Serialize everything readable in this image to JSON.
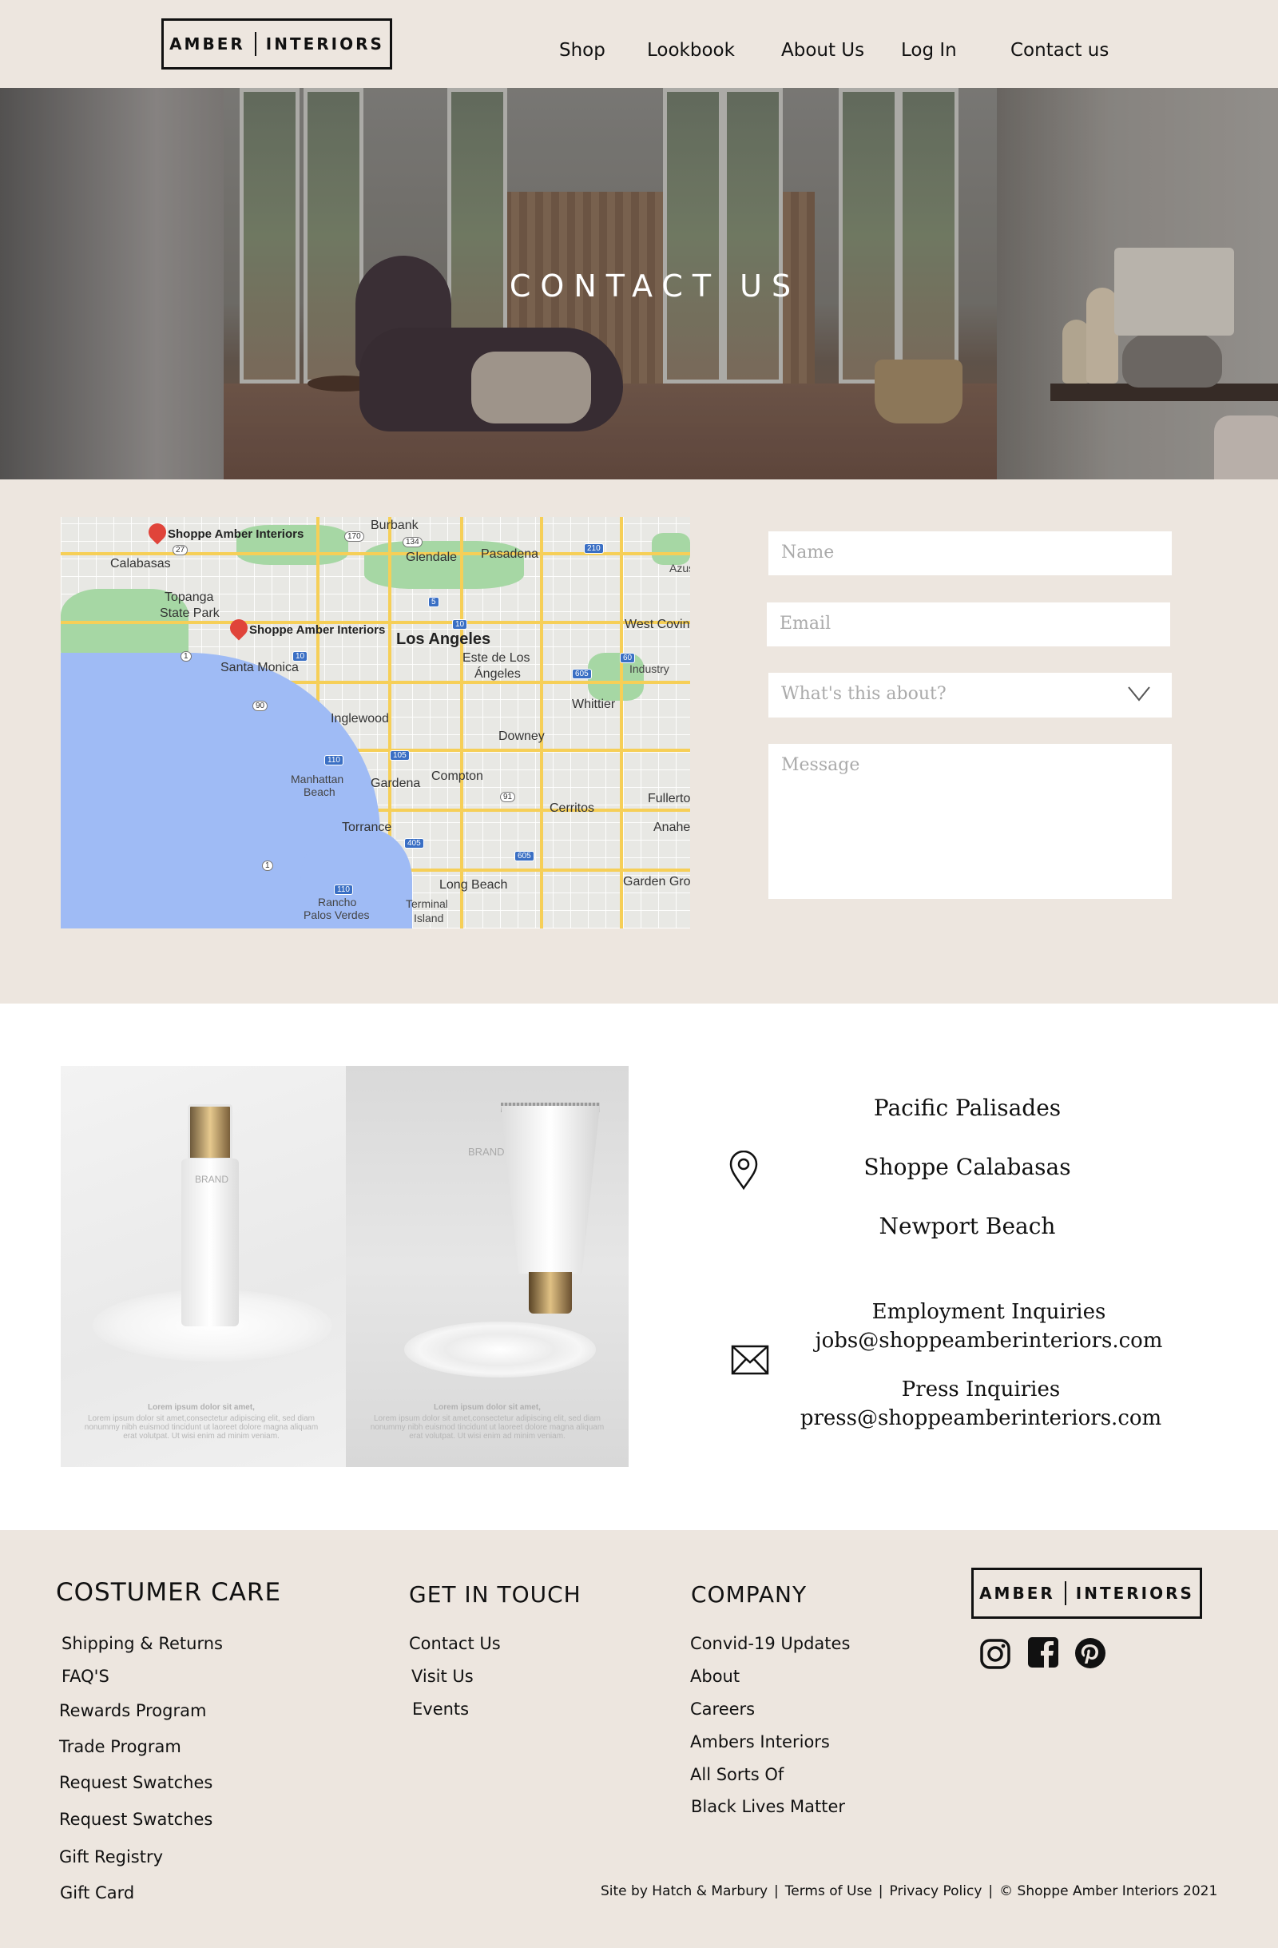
{
  "header": {
    "logo_left": "AMBER",
    "logo_right": "INTERIORS",
    "nav": [
      "Shop",
      "Lookbook",
      "About Us",
      "Log In",
      "Contact us"
    ]
  },
  "hero": {
    "title": "CONTACT US"
  },
  "map": {
    "pins": [
      "Shoppe Amber Interiors",
      "Shoppe Amber Interiors"
    ],
    "places": [
      "Burbank",
      "Glendale",
      "Pasadena",
      "Calabasas",
      "Topanga",
      "State Park",
      "Los Angeles",
      "West Covina",
      "Santa Monica",
      "Este de Los",
      "Ángeles",
      "Industry",
      "Whittier",
      "Inglewood",
      "Downey",
      "Manhattan",
      "Beach",
      "Gardena",
      "Compton",
      "Cerritos",
      "Fullerton",
      "Torrance",
      "Anaheim",
      "Long Beach",
      "Garden Grove",
      "Rancho",
      "Palos Verdes",
      "Terminal",
      "Island",
      "Azusa"
    ],
    "shields": [
      "170",
      "134",
      "210",
      "210",
      "27",
      "5",
      "10",
      "10",
      "60",
      "605",
      "90",
      "110",
      "105",
      "91",
      "405",
      "605",
      "1",
      "1",
      "110"
    ]
  },
  "form": {
    "name_placeholder": "Name",
    "email_placeholder": "Email",
    "topic_placeholder": "What's this about?",
    "message_placeholder": "Message"
  },
  "product": {
    "brand_1": "BRAND",
    "brand_2": "BRAND",
    "lorem_title_1": "Lorem ipsum dolor sit amet,",
    "lorem_body_1": "Lorem ipsum dolor sit amet,consectetur adipiscing elit, sed diam nonummy nibh euismod tincidunt ut laoreet dolore magna aliquam erat volutpat. Ut wisi enim ad minim veniam.",
    "lorem_title_2": "Lorem ipsum dolor sit amet,",
    "lorem_body_2": "Lorem ipsum dolor sit amet,consectetur adipiscing elit, sed diam nonummy nibh euismod tincidunt ut laoreet dolore magna aliquam erat volutpat. Ut wisi enim ad minim veniam."
  },
  "locations": [
    "Pacific Palisades",
    "Shoppe Calabasas",
    "Newport Beach"
  ],
  "inquiries": {
    "employment_label": "Employment Inquiries",
    "employment_email": "jobs@shoppeamberinteriors.com",
    "press_label": "Press Inquiries",
    "press_email": "press@shoppeamberinteriors.com"
  },
  "footer": {
    "care_title": "COSTUMER  CARE",
    "care_links": [
      "Shipping & Returns",
      "FAQ'S",
      "Rewards Program",
      "Trade Program",
      "Request Swatches",
      "Request Swatches",
      "Gift Registry",
      "Gift Card"
    ],
    "touch_title": "GET IN TOUCH",
    "touch_links": [
      "Contact Us",
      "Visit Us",
      "Events"
    ],
    "company_title": "COMPANY",
    "company_links": [
      "Convid-19 Updates",
      "About",
      "Careers",
      "Ambers Interiors",
      "All Sorts Of",
      "Black Lives Matter"
    ],
    "logo_left": "AMBER",
    "logo_right": "INTERIORS",
    "social": [
      "instagram-icon",
      "facebook-icon",
      "pinterest-icon"
    ],
    "legal": [
      "Site by Hatch & Marbury",
      "Terms of Use",
      "Privacy Policy",
      "© Shoppe Amber Interiors 2021"
    ]
  },
  "colors": {
    "beige": "#ede6df",
    "text": "#111111",
    "placeholder": "#aaaaaa"
  }
}
